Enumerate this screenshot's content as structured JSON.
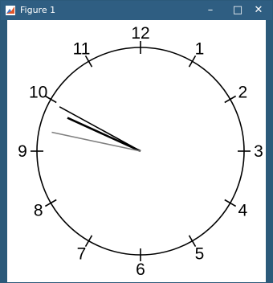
{
  "window": {
    "title": "Figure 1",
    "minimize_glyph": "–",
    "maximize_glyph": "□",
    "close_glyph": "✕",
    "app_icon": "matlab-figure-icon"
  },
  "clock": {
    "numbers": [
      "12",
      "1",
      "2",
      "3",
      "4",
      "5",
      "6",
      "7",
      "8",
      "9",
      "10",
      "11"
    ],
    "time": {
      "hour": 9,
      "minute": 49,
      "second": 47
    },
    "colors": {
      "face_outline": "#000000",
      "hour_hand": "#000000",
      "minute_hand": "#000000",
      "second_hand": "#808080"
    }
  }
}
